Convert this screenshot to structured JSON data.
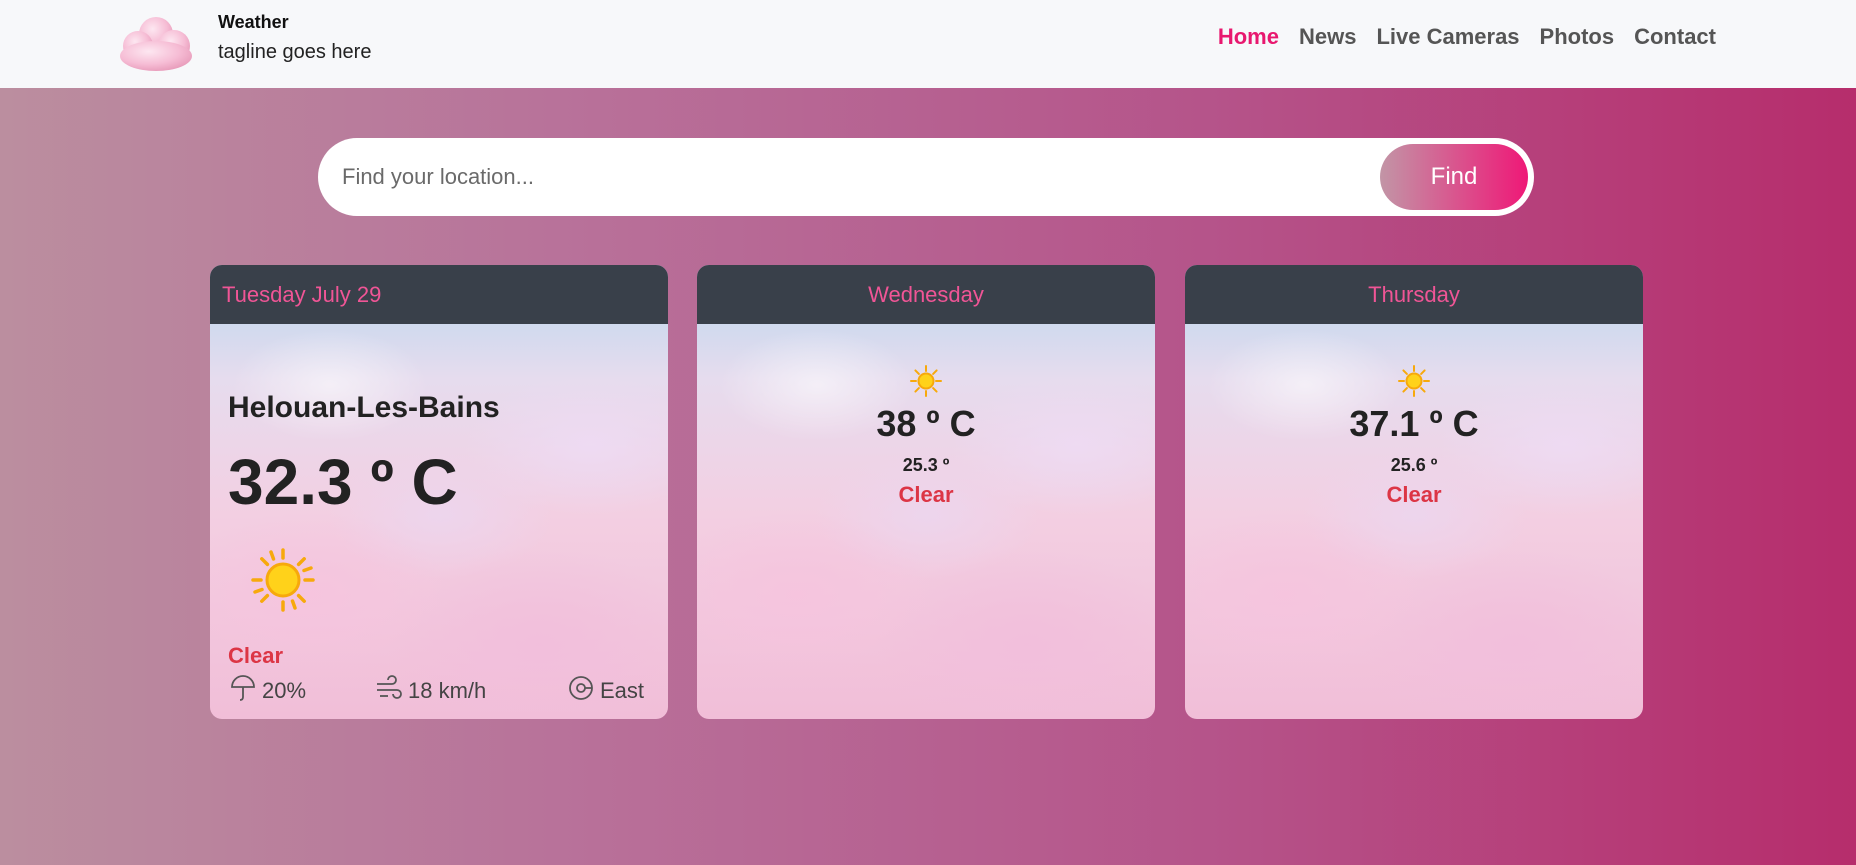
{
  "header": {
    "title": "Weather",
    "tagline": "tagline goes here",
    "nav": [
      {
        "label": "Home",
        "active": true
      },
      {
        "label": "News"
      },
      {
        "label": "Live Cameras"
      },
      {
        "label": "Photos"
      },
      {
        "label": "Contact"
      }
    ]
  },
  "search": {
    "placeholder": "Find your location...",
    "button_label": "Find"
  },
  "today": {
    "date": "Tuesday July 29",
    "city": "Helouan-Les-Bains",
    "temp": "32.3 º C",
    "icon": "sun-icon",
    "condition": "Clear",
    "humidity": "20%",
    "wind_speed": "18 km/h",
    "wind_dir": "East"
  },
  "forecast": [
    {
      "day": "Wednesday",
      "icon": "sun-icon",
      "max": "38 º C",
      "min": "25.3 º",
      "condition": "Clear"
    },
    {
      "day": "Thursday",
      "icon": "sun-icon",
      "max": "37.1 º C",
      "min": "25.6 º",
      "condition": "Clear"
    }
  ],
  "colors": {
    "accent": "#e8186f",
    "condition": "#dc3545",
    "card_header": "#39404a"
  }
}
